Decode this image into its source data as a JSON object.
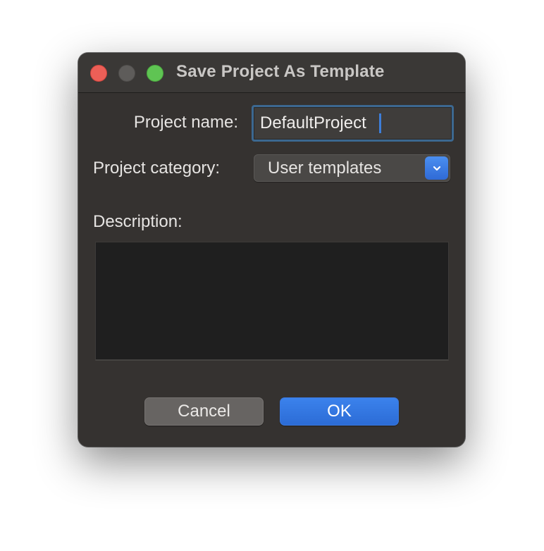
{
  "window": {
    "title": "Save Project As Template"
  },
  "form": {
    "project_name_label": "Project name:",
    "project_name_value": "DefaultProject",
    "project_category_label": "Project category:",
    "project_category_value": "User templates",
    "description_label": "Description:",
    "description_value": ""
  },
  "buttons": {
    "cancel_label": "Cancel",
    "ok_label": "OK"
  },
  "icons": {
    "close": "close-traffic-light",
    "minimize": "minimize-traffic-light",
    "zoom": "zoom-traffic-light",
    "select_arrow": "chevron-down-icon"
  },
  "colors": {
    "window_bg": "#353230",
    "accent": "#2f6ad6",
    "close": "#ec5f57",
    "zoom": "#5fc453"
  }
}
